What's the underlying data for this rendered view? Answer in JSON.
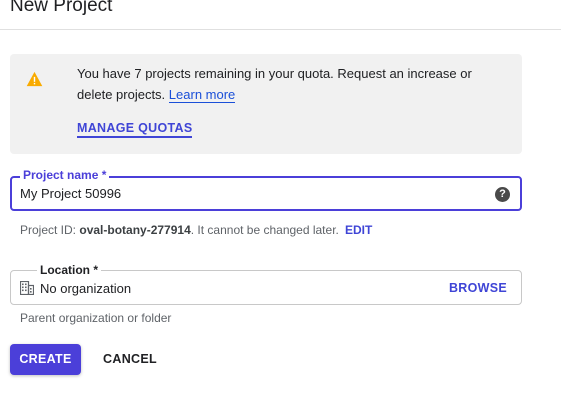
{
  "page": {
    "title": "New Project"
  },
  "quota_notice": {
    "message": "You have 7 projects remaining in your quota. Request an increase or delete projects.",
    "learn_more": "Learn more",
    "manage_quotas": "MANAGE QUOTAS",
    "icon": "warning-icon",
    "warning_color": "#f9ab00"
  },
  "project_name": {
    "label": "Project name *",
    "value": "My Project 50996",
    "help_icon": "help-icon"
  },
  "project_id": {
    "prefix": "Project ID: ",
    "value": "oval-botany-277914",
    "suffix": ". It cannot be changed later.",
    "edit_label": "EDIT"
  },
  "location": {
    "label": "Location *",
    "value": "No organization",
    "browse_label": "BROWSE",
    "helper": "Parent organization or folder",
    "icon": "building-icon"
  },
  "actions": {
    "create_label": "CREATE",
    "cancel_label": "CANCEL"
  },
  "colors": {
    "accent": "#4b3fd9",
    "link": "#1a4fd8",
    "notice_bg": "#f1f1f1"
  }
}
